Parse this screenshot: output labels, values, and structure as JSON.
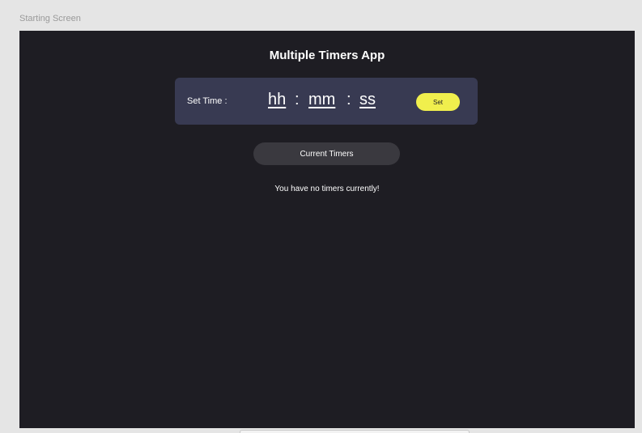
{
  "frame": {
    "label": "Starting Screen"
  },
  "app": {
    "title": "Multiple Timers App"
  },
  "time_panel": {
    "label": "Set Time :",
    "hours_placeholder": "hh",
    "minutes_placeholder": "mm",
    "seconds_placeholder": "ss",
    "separator": ":",
    "set_label": "Set"
  },
  "timers": {
    "button_label": "Current Timers",
    "empty_message": "You have no timers currently!"
  },
  "colors": {
    "background": "#1e1d23",
    "panel": "#383a52",
    "accent": "#f0ef4d",
    "button": "#3a393f"
  }
}
